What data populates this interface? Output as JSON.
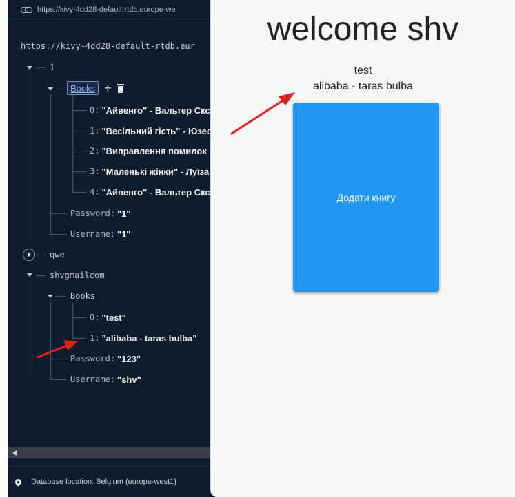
{
  "db": {
    "topbar_url": "https://kivy-4dd28-default-rtdb.europe-we",
    "url": "https://kivy-4dd28-default-rtdb.eur",
    "root_key": "1",
    "books_key": "Books",
    "books": [
      {
        "index": "0",
        "value": "\"Айвенго\" - Вальтер Скс"
      },
      {
        "index": "1",
        "value": "\"Весільний гість\" - Юзеф"
      },
      {
        "index": "2",
        "value": "\"Виправлення помилок"
      },
      {
        "index": "3",
        "value": "\"Маленькі жінки\" - Луїза"
      },
      {
        "index": "4",
        "value": "\"Айвенго\" - Вальтер Скс"
      }
    ],
    "password_key": "Password",
    "password_val": "\"1\"",
    "username_key": "Username",
    "username_val": "\"1\"",
    "qwe_key": "qwe",
    "shv_key": "shvgmailcom",
    "shv_books_key": "Books",
    "shv_books": [
      {
        "index": "0",
        "value": "\"test\""
      },
      {
        "index": "1",
        "value": "\"alibaba - taras bulba\""
      }
    ],
    "shv_password_key": "Password",
    "shv_password_val": "\"123\"",
    "shv_username_key": "Username",
    "shv_username_val": "\"shv\"",
    "footer": "Database location: Belgium (europe-west1)"
  },
  "app": {
    "welcome": "welcome shv",
    "books": [
      "test",
      "alibaba - taras bulba"
    ],
    "add_button": "Додати книгу"
  },
  "colors": {
    "db_bg": "#0f1b2e",
    "app_bg": "#f7f7f7",
    "button_bg": "#2196f3",
    "arrow": "#e0201b"
  }
}
